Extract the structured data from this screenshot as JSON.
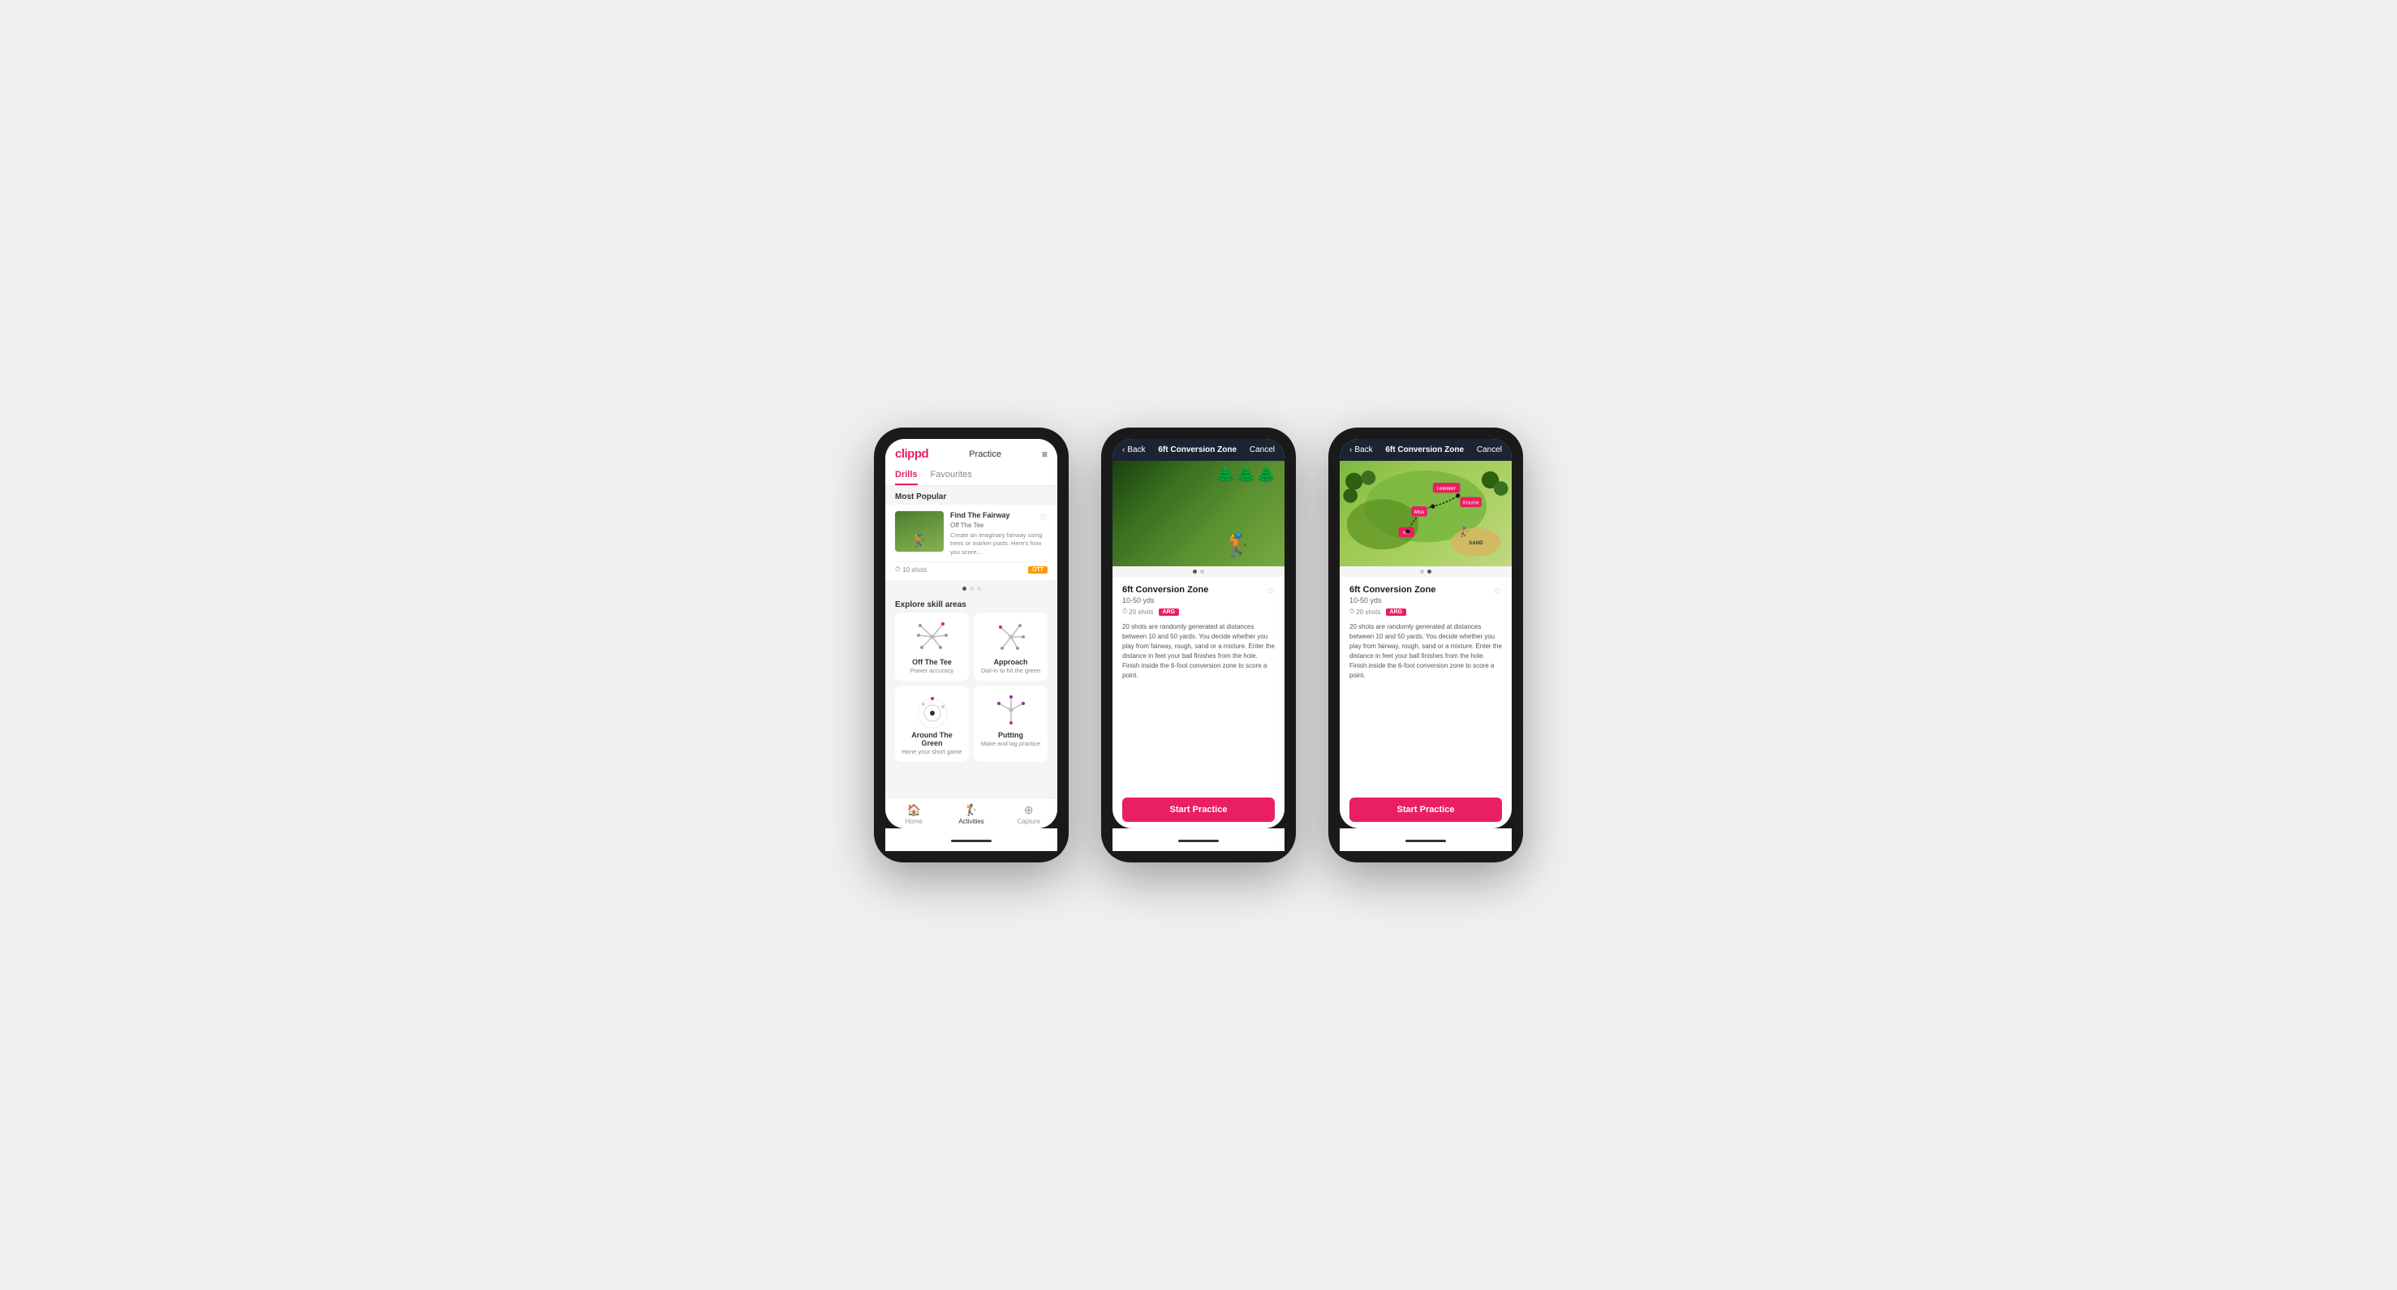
{
  "app": {
    "logo": "clippd",
    "header_title": "Practice",
    "menu_icon": "≡"
  },
  "screen1": {
    "tabs": [
      {
        "label": "Drills",
        "active": true
      },
      {
        "label": "Favourites",
        "active": false
      }
    ],
    "most_popular_title": "Most Popular",
    "featured_card": {
      "title": "Find The Fairway",
      "subtitle": "Off The Tee",
      "description": "Create an imaginary fairway using trees or marker posts. Here's how you score...",
      "shots": "10 shots",
      "badge": "OTT"
    },
    "dots": [
      true,
      false,
      false
    ],
    "explore_title": "Explore skill areas",
    "skills": [
      {
        "name": "Off The Tee",
        "desc": "Power accuracy",
        "icon": "ott"
      },
      {
        "name": "Approach",
        "desc": "Dial-in to hit the green",
        "icon": "approach"
      },
      {
        "name": "Around The Green",
        "desc": "Hone your short game",
        "icon": "atg"
      },
      {
        "name": "Putting",
        "desc": "Make and lag practice",
        "icon": "putting"
      }
    ],
    "nav_items": [
      {
        "label": "Home",
        "icon": "🏠",
        "active": false
      },
      {
        "label": "Activities",
        "icon": "🏌",
        "active": true
      },
      {
        "label": "Capture",
        "icon": "⊕",
        "active": false
      }
    ]
  },
  "screen2": {
    "back_label": "Back",
    "title": "6ft Conversion Zone",
    "cancel_label": "Cancel",
    "drill_title": "6ft Conversion Zone",
    "range": "10-50 yds",
    "shots": "20 shots",
    "badge": "ARG",
    "description": "20 shots are randomly generated at distances between 10 and 50 yards. You decide whether you play from fairway, rough, sand or a mixture. Enter the distance in feet your ball finishes from the hole. Finish inside the 6-foot conversion zone to score a point.",
    "start_btn": "Start Practice",
    "dots": [
      true,
      false
    ],
    "image_type": "photo"
  },
  "screen3": {
    "back_label": "Back",
    "title": "6ft Conversion Zone",
    "cancel_label": "Cancel",
    "drill_title": "6ft Conversion Zone",
    "range": "10-50 yds",
    "shots": "20 shots",
    "badge": "ARG",
    "description": "20 shots are randomly generated at distances between 10 and 50 yards. You decide whether you play from fairway, rough, sand or a mixture. Enter the distance in feet your ball finishes from the hole. Finish inside the 6-foot conversion zone to score a point.",
    "start_btn": "Start Practice",
    "dots": [
      false,
      true
    ],
    "image_type": "map"
  }
}
